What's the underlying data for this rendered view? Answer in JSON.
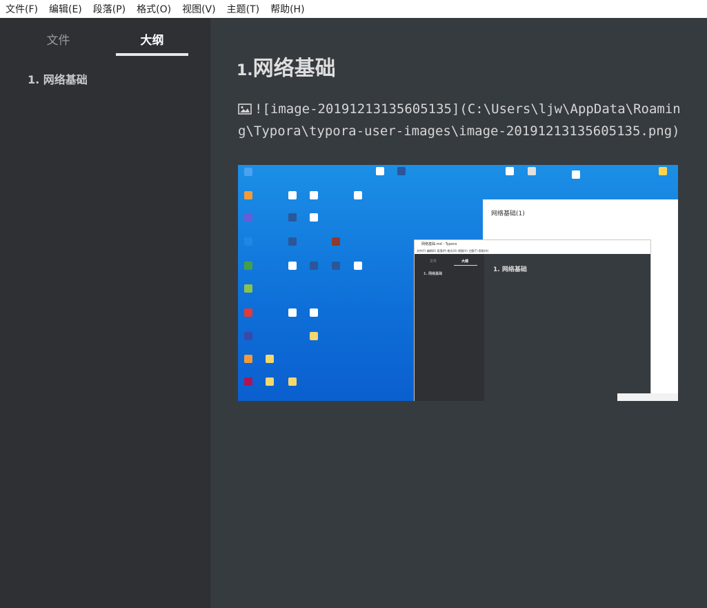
{
  "menubar": {
    "items": [
      "文件(F)",
      "编辑(E)",
      "段落(P)",
      "格式(O)",
      "视图(V)",
      "主题(T)",
      "帮助(H)"
    ]
  },
  "sidebar": {
    "tabs": [
      {
        "label": "文件",
        "active": false
      },
      {
        "label": "大纲",
        "active": true
      }
    ],
    "outline": [
      {
        "label": "1. 网络基础"
      }
    ]
  },
  "content": {
    "heading_number": "1.",
    "heading_text": "网络基础",
    "image_markdown": "![image-20191213135605135](C:\\Users\\ljw\\AppData\\Roaming\\Typora\\typora-user-images\\image-20191213135605135.png)"
  },
  "embedded_screenshot": {
    "back_window_title": "网络基础(1)",
    "front_window_title": "网络基础.md - Typora",
    "front_menu": "文件(F)  编辑(E)  段落(P)  格式(O)  视图(V)  主题(T)  帮助(H)",
    "front_tabs": [
      "文件",
      "大纲"
    ],
    "front_outline_item": "1. 网络基础",
    "front_heading": "1. 网络基础"
  },
  "colors": {
    "editor_bg": "#363b40",
    "sidebar_bg": "#2e3033",
    "desktop_blue": "#0e6fd8"
  }
}
